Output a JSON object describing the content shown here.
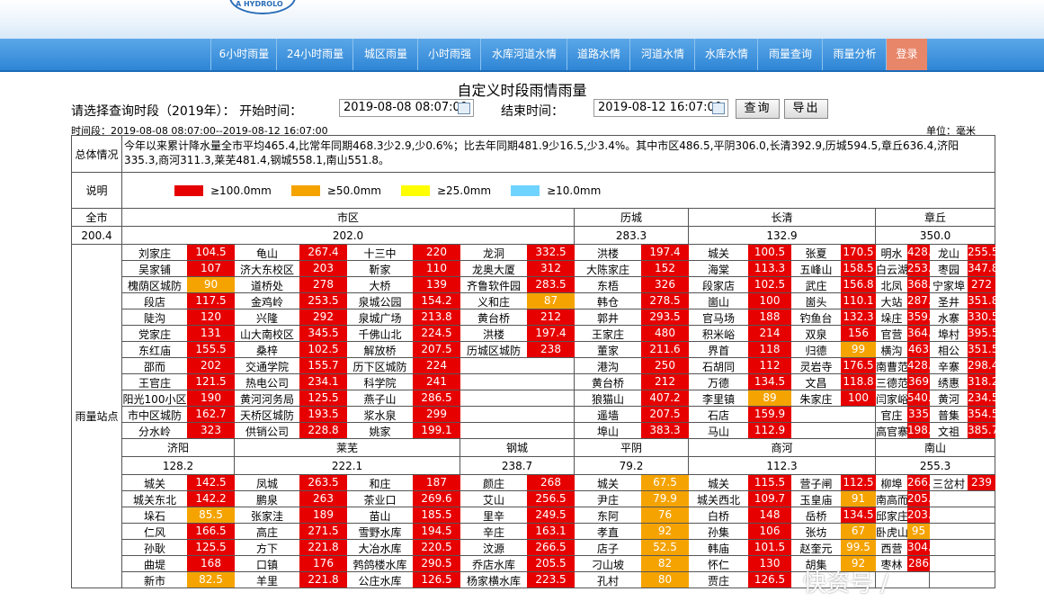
{
  "nav": [
    "6小时雨量",
    "24小时雨量",
    "城区雨量",
    "小时雨强",
    "水库河道水情",
    "道路水情",
    "河道水情",
    "水库水情",
    "雨量查询",
    "雨量分析",
    "登录"
  ],
  "header": {
    "logo_text": "A HYDROLO"
  },
  "title": "自定义时段雨情雨量",
  "query": {
    "prompt": "请选择查询时段（2019年）： 开始时间：",
    "start": "2019-08-08 08:07:00",
    "end_label": "结束时间：",
    "end": "2019-08-12 16:07:00",
    "search": "查询",
    "export": "导出"
  },
  "period": "时间段：2019-08-08 08:07:00--2019-08-12 16:07:00",
  "unit": "单位：毫米",
  "summary_label": "总体情况",
  "summary": "今年以来累计降水量全市平均465.4,比常年同期468.3少2.9,少0.6%；比去年同期481.9少16.5,少3.4%。其中市区486.5,平阴306.0,长清392.9,历城594.5,章丘636.4,济阳335.3,商河311.3,莱芜481.4,钢城558.1,南山551.8。",
  "legend_label": "说明",
  "legend": [
    {
      "color": "#e60000",
      "text": "≥100.0mm"
    },
    {
      "color": "#f5a300",
      "text": "≥50.0mm"
    },
    {
      "color": "#ffff00",
      "text": "≥25.0mm"
    },
    {
      "color": "#6fd3ff",
      "text": "≥10.0mm"
    }
  ],
  "station_label": "雨量站点",
  "city": {
    "name": "全市",
    "value": "200.4"
  },
  "districts1": [
    {
      "name": "市区",
      "value": "202.0"
    },
    {
      "name": "历城",
      "value": "283.3"
    },
    {
      "name": "长清",
      "value": "132.9"
    },
    {
      "name": "章丘",
      "value": "350.0"
    }
  ],
  "grid1": [
    [
      [
        "刘家庄",
        "104.5"
      ],
      [
        "龟山",
        "267.4"
      ],
      [
        "十三中",
        "220"
      ],
      [
        "龙洞",
        "332.5"
      ],
      [
        "洪楼",
        "197.4"
      ],
      [
        "城关",
        "100.5"
      ],
      [
        "张夏",
        "170.5"
      ],
      [
        "明水",
        "428.4"
      ],
      [
        "龙山",
        "255.5"
      ]
    ],
    [
      [
        "吴家铺",
        "107"
      ],
      [
        "济大东校区",
        "203"
      ],
      [
        "靳家",
        "110"
      ],
      [
        "龙奥大厦",
        "312"
      ],
      [
        "大陈家庄",
        "152"
      ],
      [
        "海棠",
        "113.3"
      ],
      [
        "五峰山",
        "158.5"
      ],
      [
        "白云湖",
        "253.5"
      ],
      [
        "枣园",
        "347.8"
      ]
    ],
    [
      [
        "槐荫区城防",
        "90"
      ],
      [
        "道桥处",
        "278"
      ],
      [
        "大桥",
        "139"
      ],
      [
        "齐鲁软件园",
        "283.5"
      ],
      [
        "东梧",
        "326"
      ],
      [
        "段家店",
        "102.5"
      ],
      [
        "武庄",
        "156.8"
      ],
      [
        "北凤",
        "368.5"
      ],
      [
        "宁家埠",
        "272"
      ]
    ],
    [
      [
        "段店",
        "117.5"
      ],
      [
        "金鸡岭",
        "253.5"
      ],
      [
        "泉城公园",
        "154.2"
      ],
      [
        "义和庄",
        "87"
      ],
      [
        "韩仓",
        "278.5"
      ],
      [
        "崮山",
        "100"
      ],
      [
        "崮头",
        "110.1"
      ],
      [
        "大站",
        "287.5"
      ],
      [
        "圣井",
        "351.8"
      ]
    ],
    [
      [
        "陡沟",
        "120"
      ],
      [
        "兴隆",
        "292"
      ],
      [
        "泉城广场",
        "213.8"
      ],
      [
        "黄台桥",
        "212"
      ],
      [
        "郭井",
        "293.5"
      ],
      [
        "官马场",
        "188"
      ],
      [
        "钓鱼台",
        "132.3"
      ],
      [
        "垛庄",
        "359.8"
      ],
      [
        "水寨",
        "330.5"
      ]
    ],
    [
      [
        "党家庄",
        "131"
      ],
      [
        "山大南校区",
        "345.5"
      ],
      [
        "千佛山北",
        "224.5"
      ],
      [
        "洪楼",
        "197.4"
      ],
      [
        "王家庄",
        "480"
      ],
      [
        "积米峪",
        "214"
      ],
      [
        "双泉",
        "156"
      ],
      [
        "官营",
        "364.5"
      ],
      [
        "埠村",
        "395.5"
      ]
    ],
    [
      [
        "东红庙",
        "155.5"
      ],
      [
        "桑梓",
        "102.5"
      ],
      [
        "解放桥",
        "207.5"
      ],
      [
        "历城区城防",
        "238"
      ],
      [
        "董家",
        "211.6"
      ],
      [
        "界首",
        "118"
      ],
      [
        "归德",
        "99"
      ],
      [
        "横沟",
        "463"
      ],
      [
        "相公",
        "351.5"
      ]
    ],
    [
      [
        "邵而",
        "202"
      ],
      [
        "交通学院",
        "155.7"
      ],
      [
        "历下区城防",
        "224"
      ],
      [
        "",
        ""
      ],
      [
        "港沟",
        "250"
      ],
      [
        "石胡同",
        "112"
      ],
      [
        "灵岩寺",
        "176.5"
      ],
      [
        "南曹范",
        "428.5"
      ],
      [
        "辛寨",
        "298.4"
      ]
    ],
    [
      [
        "王官庄",
        "121.5"
      ],
      [
        "热电公司",
        "234.1"
      ],
      [
        "科学院",
        "241"
      ],
      [
        "",
        ""
      ],
      [
        "黄台桥",
        "212"
      ],
      [
        "万德",
        "134.5"
      ],
      [
        "文昌",
        "118.8"
      ],
      [
        "三德范",
        "369"
      ],
      [
        "绣惠",
        "318.2"
      ]
    ],
    [
      [
        "阳光100小区",
        "190"
      ],
      [
        "黄河河务局",
        "125.5"
      ],
      [
        "燕子山",
        "286.5"
      ],
      [
        "",
        ""
      ],
      [
        "狼猫山",
        "407.2"
      ],
      [
        "李里镇",
        "89"
      ],
      [
        "朱家庄",
        "100"
      ],
      [
        "闫家峪",
        "540.5"
      ],
      [
        "黄河",
        "234.5"
      ]
    ],
    [
      [
        "市中区城防",
        "162.7"
      ],
      [
        "天桥区城防",
        "193.5"
      ],
      [
        "浆水泉",
        "299"
      ],
      [
        "",
        ""
      ],
      [
        "遥墙",
        "207.5"
      ],
      [
        "石店",
        "159.9"
      ],
      [
        "",
        ""
      ],
      [
        "官庄",
        "335"
      ],
      [
        "普集",
        "354.5"
      ]
    ],
    [
      [
        "分水岭",
        "323"
      ],
      [
        "供销公司",
        "228.8"
      ],
      [
        "姚家",
        "199.1"
      ],
      [
        "",
        ""
      ],
      [
        "埠山",
        "383.3"
      ],
      [
        "马山",
        "112.9"
      ],
      [
        "",
        ""
      ],
      [
        "高官寨",
        "198.5"
      ],
      [
        "文祖",
        "385.7"
      ]
    ]
  ],
  "districts2": [
    {
      "name": "济阳",
      "value": "128.2"
    },
    {
      "name": "莱芜",
      "value": "222.1"
    },
    {
      "name": "钢城",
      "value": "238.7"
    },
    {
      "name": "平阴",
      "value": "79.2"
    },
    {
      "name": "商河",
      "value": "112.3"
    },
    {
      "name": "南山",
      "value": "255.3"
    }
  ],
  "grid2": [
    [
      [
        "城关",
        "142.5"
      ],
      [
        "凤城",
        "263.5"
      ],
      [
        "和庄",
        "187"
      ],
      [
        "颜庄",
        "268"
      ],
      [
        "城关",
        "67.5"
      ],
      [
        "城关",
        "115.5"
      ],
      [
        "营子闸",
        "112.5"
      ],
      [
        "柳埠",
        "266.4"
      ],
      [
        "三岔村",
        "239"
      ]
    ],
    [
      [
        "城关东北",
        "142.2"
      ],
      [
        "鹏泉",
        "263"
      ],
      [
        "茶业口",
        "269.6"
      ],
      [
        "艾山",
        "256.5"
      ],
      [
        "尹庄",
        "79.9"
      ],
      [
        "城关西北",
        "109.7"
      ],
      [
        "玉皇庙",
        "91"
      ],
      [
        "南高而",
        "205.5"
      ],
      [
        "",
        ""
      ]
    ],
    [
      [
        "垛石",
        "85.5"
      ],
      [
        "张家洼",
        "189"
      ],
      [
        "苗山",
        "185.5"
      ],
      [
        "里辛",
        "249.5"
      ],
      [
        "东阿",
        "76"
      ],
      [
        "白桥",
        "148"
      ],
      [
        "岳桥",
        "134.5"
      ],
      [
        "邱家庄",
        "203.5"
      ],
      [
        "",
        ""
      ]
    ],
    [
      [
        "仁风",
        "166.5"
      ],
      [
        "高庄",
        "271.5"
      ],
      [
        "雪野水库",
        "194.5"
      ],
      [
        "辛庄",
        "163.1"
      ],
      [
        "孝直",
        "92"
      ],
      [
        "孙集",
        "106"
      ],
      [
        "张坊",
        "67"
      ],
      [
        "卧虎山",
        "95"
      ],
      [
        "",
        ""
      ]
    ],
    [
      [
        "孙耿",
        "125.5"
      ],
      [
        "方下",
        "221.8"
      ],
      [
        "大冶水库",
        "220.5"
      ],
      [
        "汶源",
        "266.5"
      ],
      [
        "店子",
        "52.5"
      ],
      [
        "韩庙",
        "101.5"
      ],
      [
        "赵奎元",
        "99.5"
      ],
      [
        "西营",
        "304.8"
      ],
      [
        "",
        ""
      ]
    ],
    [
      [
        "曲堤",
        "168"
      ],
      [
        "口镇",
        "176"
      ],
      [
        "鹁鸽楼水库",
        "290.5"
      ],
      [
        "乔店水库",
        "205.5"
      ],
      [
        "刁山坡",
        "82"
      ],
      [
        "怀仁",
        "130"
      ],
      [
        "胡集",
        "92"
      ],
      [
        "枣林",
        "286"
      ],
      [
        "",
        ""
      ]
    ],
    [
      [
        "新市",
        "82.5"
      ],
      [
        "羊里",
        "221.8"
      ],
      [
        "公庄水库",
        "126.5"
      ],
      [
        "杨家横水库",
        "223.5"
      ],
      [
        "孔村",
        "80"
      ],
      [
        "贾庄",
        "126.5"
      ],
      [
        "",
        ""
      ],
      [
        "",
        ""
      ],
      [
        "",
        ""
      ]
    ]
  ],
  "watermark": "快资号 /"
}
